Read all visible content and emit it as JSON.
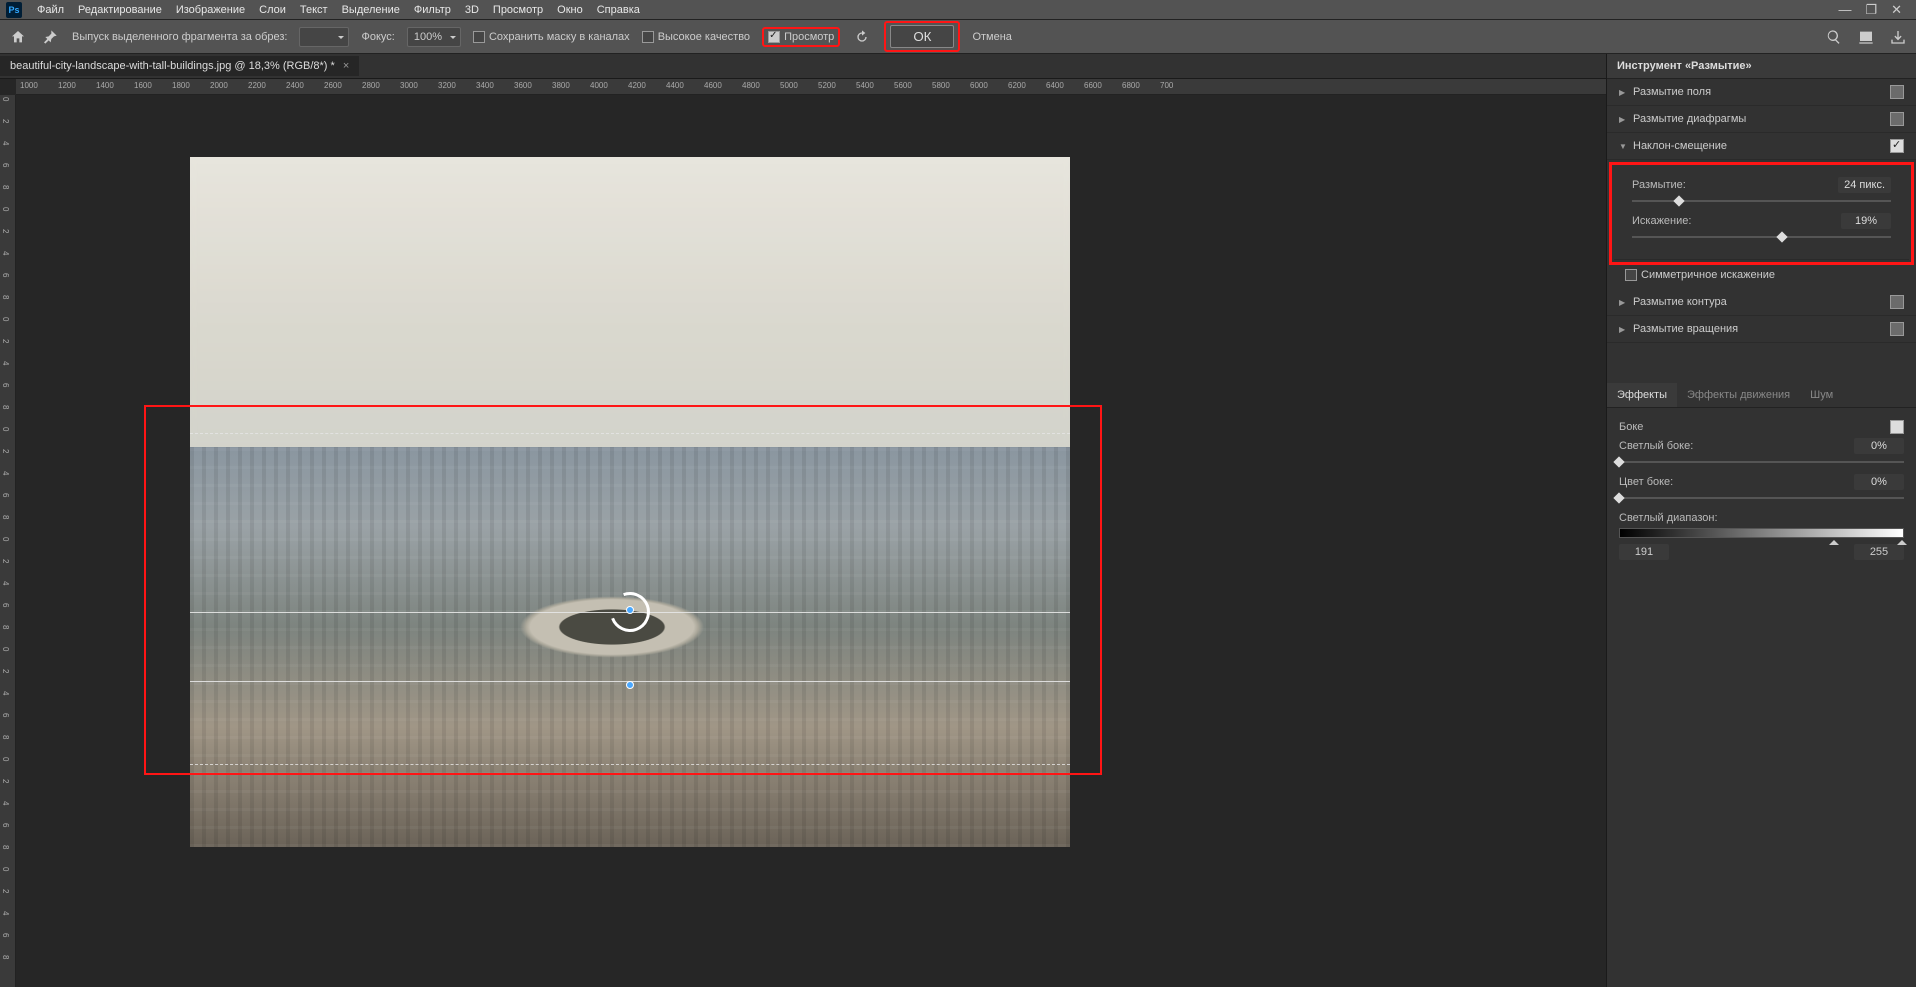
{
  "menu": {
    "items": [
      "Файл",
      "Редактирование",
      "Изображение",
      "Слои",
      "Текст",
      "Выделение",
      "Фильтр",
      "3D",
      "Просмотр",
      "Окно",
      "Справка"
    ]
  },
  "optbar": {
    "crop_label": "Выпуск выделенного фрагмента за обрез:",
    "focus_label": "Фокус:",
    "focus_value": "100%",
    "mask_label": "Сохранить маску в каналах",
    "mask_on": false,
    "hq_label": "Высокое качество",
    "hq_on": false,
    "preview_label": "Просмотр",
    "preview_on": true,
    "ok": "ОК",
    "cancel": "Отмена"
  },
  "tab": {
    "title": "beautiful-city-landscape-with-tall-buildings.jpg @ 18,3% (RGB/8*) *"
  },
  "ruler_h": [
    "1000",
    "1200",
    "1400",
    "1600",
    "1800",
    "2000",
    "2200",
    "2400",
    "2600",
    "2800",
    "3000",
    "3200",
    "3400",
    "3600",
    "3800",
    "4000",
    "4200",
    "4400",
    "4600",
    "4800",
    "5000",
    "5200",
    "5400",
    "5600",
    "5800",
    "6000",
    "6200",
    "6400",
    "6600",
    "6800",
    "700"
  ],
  "panel": {
    "title": "Инструмент «Размытие»",
    "sections": [
      {
        "label": "Размытие поля",
        "open": false,
        "on": false
      },
      {
        "label": "Размытие диафрагмы",
        "open": false,
        "on": false
      },
      {
        "label": "Наклон-смещение",
        "open": true,
        "on": true
      },
      {
        "label": "Размытие контура",
        "open": false,
        "on": false
      },
      {
        "label": "Размытие вращения",
        "open": false,
        "on": false
      }
    ],
    "tilt": {
      "blur_label": "Размытие:",
      "blur_value": "24 пикс.",
      "blur_pct": 18,
      "dist_label": "Искажение:",
      "dist_value": "19%",
      "dist_pct": 58,
      "sym_label": "Симметричное искажение",
      "sym_on": false
    }
  },
  "fx": {
    "tabs": [
      "Эффекты",
      "Эффекты движения",
      "Шум"
    ],
    "bokeh": "Боке",
    "bokeh_on": true,
    "light": "Светлый боке:",
    "light_val": "0%",
    "light_pct": 0,
    "color": "Цвет боке:",
    "color_val": "0%",
    "color_pct": 0,
    "range": "Светлый диапазон:",
    "range_lo": "191",
    "range_hi": "255"
  }
}
